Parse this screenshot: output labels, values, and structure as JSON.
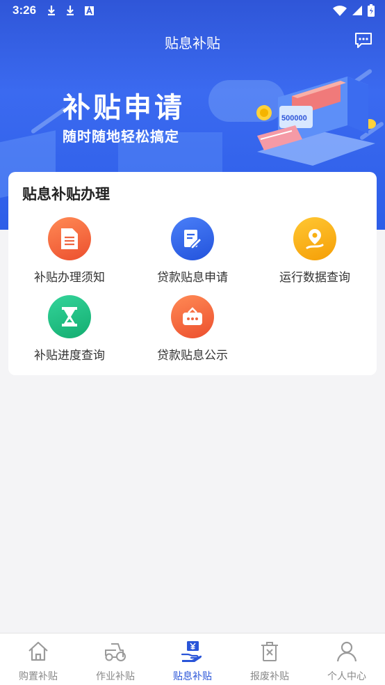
{
  "status_bar": {
    "time": "3:26"
  },
  "header": {
    "title": "贴息补贴",
    "message_icon": "message-icon"
  },
  "banner": {
    "title": "补贴申请",
    "subtitle": "随时随地轻松搞定",
    "machine_text": "500000"
  },
  "service_card": {
    "heading": "贴息补贴办理",
    "items": [
      {
        "label": "补贴办理须知",
        "icon": "document-icon",
        "color": "#f0653a"
      },
      {
        "label": "贷款贴息申请",
        "icon": "edit-form-icon",
        "color": "#2f64e8"
      },
      {
        "label": "运行数据查询",
        "icon": "location-pin-icon",
        "color": "#f8b013"
      },
      {
        "label": "补贴进度查询",
        "icon": "hourglass-icon",
        "color": "#1fbf82"
      },
      {
        "label": "贷款贴息公示",
        "icon": "notice-board-icon",
        "color": "#f0653a"
      }
    ]
  },
  "tab_bar": {
    "tabs": [
      {
        "label": "购置补贴",
        "icon": "home-icon",
        "active": false
      },
      {
        "label": "作业补贴",
        "icon": "tractor-icon",
        "active": false
      },
      {
        "label": "贴息补贴",
        "icon": "hand-yuan-icon",
        "active": true
      },
      {
        "label": "报废补贴",
        "icon": "trash-icon",
        "active": false
      },
      {
        "label": "个人中心",
        "icon": "person-icon",
        "active": false
      }
    ]
  },
  "colors": {
    "primary": "#2a55d8",
    "tab_inactive": "#888888"
  }
}
